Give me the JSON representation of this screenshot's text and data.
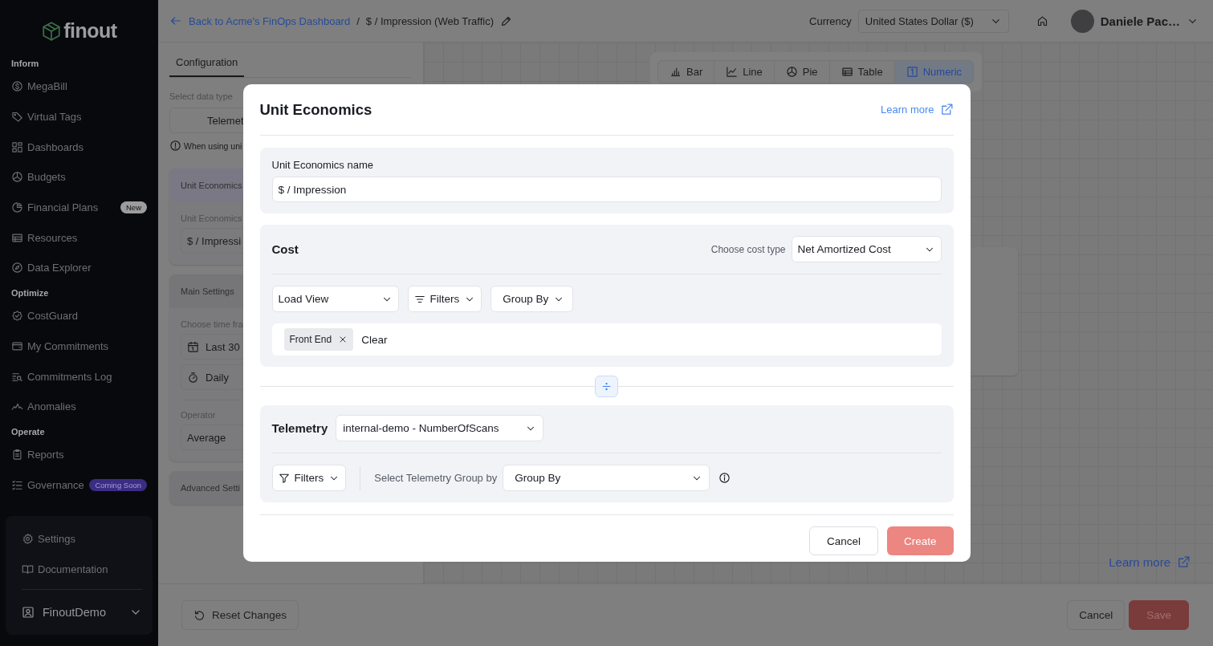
{
  "sidebar": {
    "logo": "finout",
    "sections": [
      {
        "title": "Inform",
        "items": [
          {
            "label": "MegaBill"
          },
          {
            "label": "Virtual Tags"
          },
          {
            "label": "Dashboards"
          },
          {
            "label": "Budgets"
          },
          {
            "label": "Financial Plans",
            "badge": {
              "text": "New",
              "kind": "new"
            }
          },
          {
            "label": "Resources"
          },
          {
            "label": "Data Explorer"
          }
        ]
      },
      {
        "title": "Optimize",
        "items": [
          {
            "label": "CostGuard"
          },
          {
            "label": "My Commitments"
          },
          {
            "label": "Commitments Log"
          },
          {
            "label": "Anomalies"
          }
        ]
      },
      {
        "title": "Operate",
        "items": [
          {
            "label": "Reports"
          },
          {
            "label": "Governance",
            "badge": {
              "text": "Coming Soon",
              "kind": "soon"
            }
          }
        ]
      }
    ],
    "footer": {
      "items": [
        {
          "label": "Settings"
        },
        {
          "label": "Documentation"
        }
      ],
      "account": "FinoutDemo"
    }
  },
  "topbar": {
    "back_link": "Back to Acme's FinOps Dashboard",
    "separator": "/",
    "title": "$ / Impression (Web Traffic)",
    "currency_label": "Currency",
    "currency": "United States Dollar ($)",
    "user": "Daniele Pac…"
  },
  "config_panel": {
    "tabs": [
      {
        "label": "Configuration",
        "selected": true
      }
    ],
    "data_type_label": "Select data type",
    "data_type": "Telemet",
    "note": "When using uni",
    "unit_card": {
      "header": "Unit Economics",
      "label": "Unit Economics",
      "value": "$ / Impressi"
    },
    "main_settings": {
      "header": "Main Settings",
      "time_label": "Choose time fra",
      "time_range": "Last 30",
      "granularity": "Daily",
      "operator_label": "Operator",
      "operator": "Average"
    },
    "advanced_header": "Advanced Setti"
  },
  "canvas": {
    "chart_types": [
      {
        "label": "Bar",
        "selected": false
      },
      {
        "label": "Line",
        "selected": false
      },
      {
        "label": "Pie",
        "selected": false
      },
      {
        "label": "Table",
        "selected": false
      },
      {
        "label": "Numeric",
        "selected": true
      }
    ],
    "learn_more": "Learn more"
  },
  "footer_bar": {
    "reset": "Reset Changes",
    "cancel": "Cancel",
    "save": "Save"
  },
  "modal": {
    "title": "Unit Economics",
    "learn_more": "Learn more",
    "name_label": "Unit Economics name",
    "name_value": "$ / Impression",
    "cost": {
      "title": "Cost",
      "cost_type_label": "Choose cost type",
      "cost_type": "Net Amortized Cost",
      "load_view": "Load View",
      "filters": "Filters",
      "group_by": "Group By",
      "chips": [
        {
          "label": "Front End"
        }
      ],
      "clear": "Clear"
    },
    "telemetry": {
      "title": "Telemetry",
      "source": "internal-demo - NumberOfScans",
      "filters": "Filters",
      "group_label": "Select Telemetry Group by",
      "group_by": "Group By"
    },
    "buttons": {
      "cancel": "Cancel",
      "create": "Create",
      "create_disabled": true
    }
  }
}
